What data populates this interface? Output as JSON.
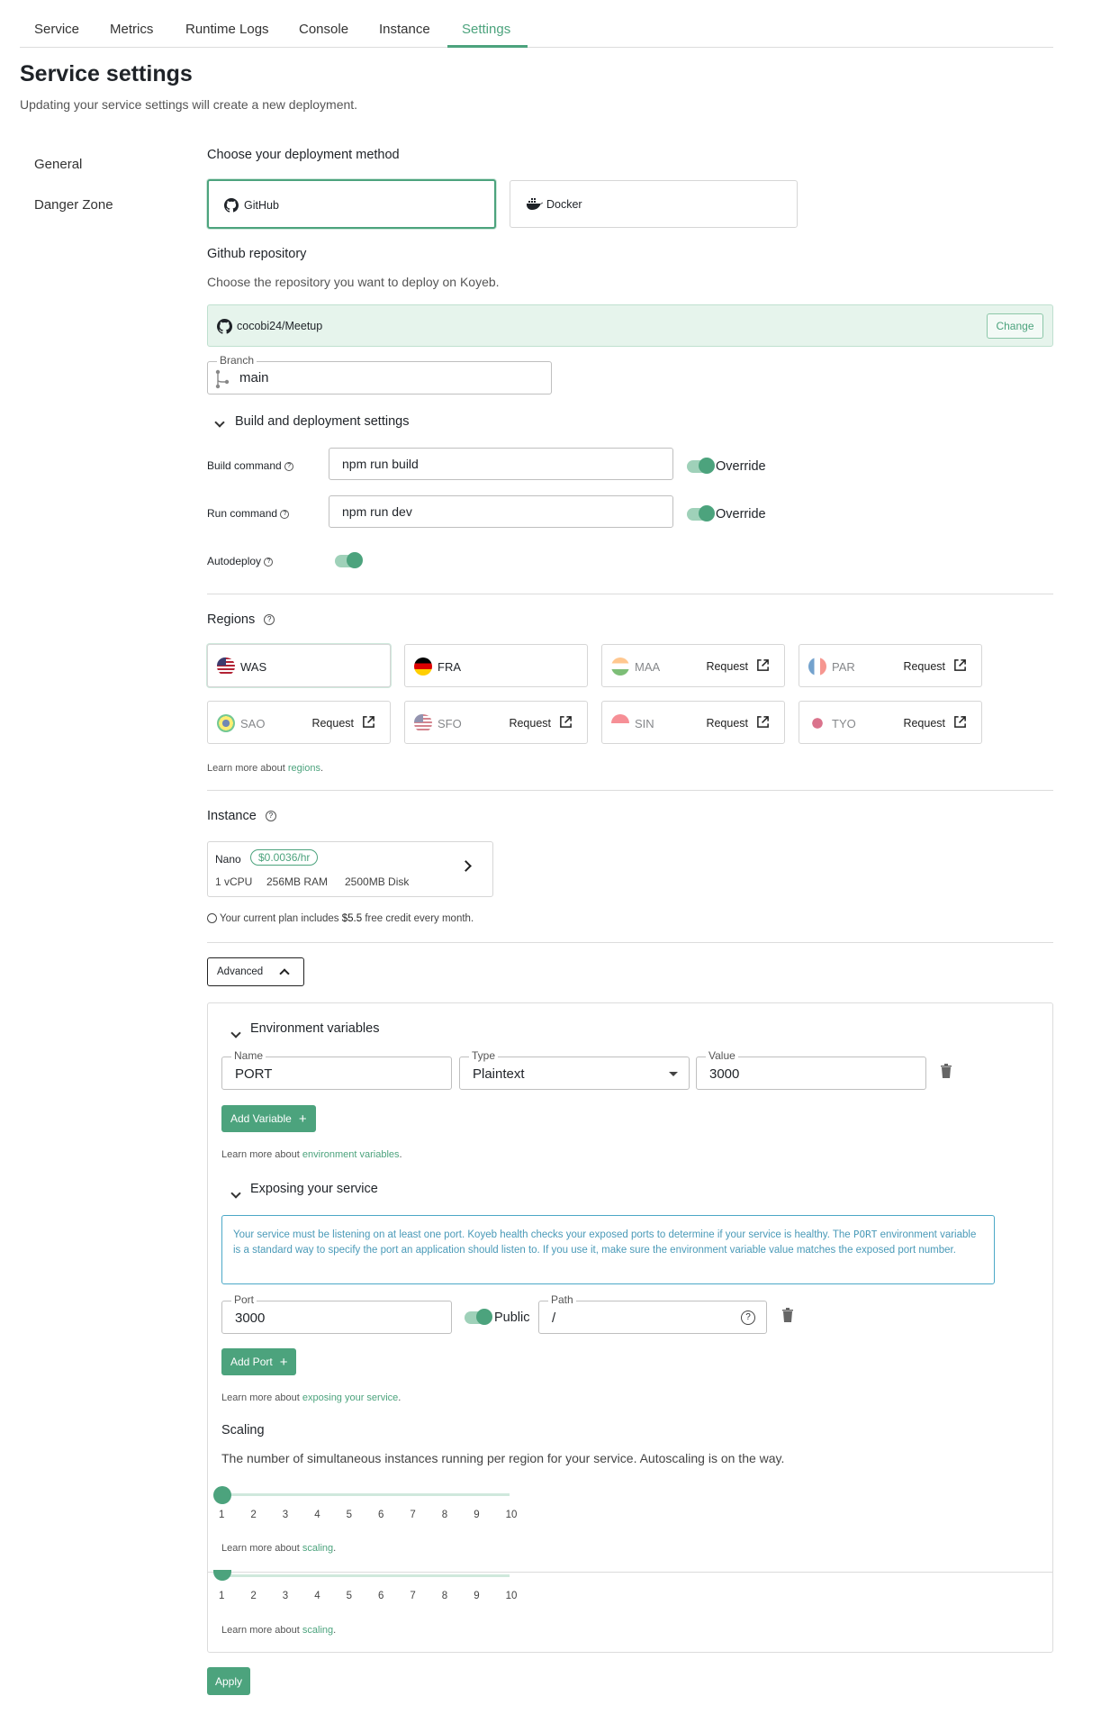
{
  "tabs": [
    "Service",
    "Metrics",
    "Runtime Logs",
    "Console",
    "Instance",
    "Settings"
  ],
  "page": {
    "title": "Service settings",
    "subtitle": "Updating your service settings will create a new deployment."
  },
  "sidebar": [
    "General",
    "Danger Zone"
  ],
  "deploy": {
    "heading": "Choose your deployment method",
    "github": "GitHub",
    "docker": "Docker"
  },
  "repo": {
    "heading": "Github repository",
    "desc": "Choose the repository you want to deploy on Koyeb.",
    "name": "cocobi24/Meetup",
    "change": "Change",
    "branch_label": "Branch",
    "branch": "main"
  },
  "build": {
    "heading": "Build and deployment settings",
    "build_label": "Build command",
    "build_value": "npm run build",
    "run_label": "Run command",
    "run_value": "npm run dev",
    "override": "Override",
    "autodeploy": "Autodeploy"
  },
  "regions": {
    "heading": "Regions",
    "request": "Request",
    "items": [
      {
        "code": "WAS",
        "selected": true
      },
      {
        "code": "FRA"
      },
      {
        "code": "MAA",
        "request": true
      },
      {
        "code": "PAR",
        "request": true
      },
      {
        "code": "SAO",
        "request": true
      },
      {
        "code": "SFO",
        "request": true
      },
      {
        "code": "SIN",
        "request": true
      },
      {
        "code": "TYO",
        "request": true
      }
    ],
    "learn_prefix": "Learn more about ",
    "learn_link": "regions",
    "learn_suffix": "."
  },
  "instance": {
    "heading": "Instance",
    "name": "Nano",
    "price": "$0.0036/hr",
    "cpu": "1 vCPU",
    "ram": "256MB RAM",
    "disk_value": "2500MB",
    "disk_unit": "Disk",
    "credit_prefix": "Your current plan includes ",
    "credit_amount": "$5.5",
    "credit_suffix": " free credit every month."
  },
  "advanced": {
    "label": "Advanced"
  },
  "env": {
    "heading": "Environment variables",
    "name_label": "Name",
    "name_value": "PORT",
    "type_label": "Type",
    "type_value": "Plaintext",
    "value_label": "Value",
    "value_value": "3000",
    "add": "Add Variable",
    "learn_prefix": "Learn more about ",
    "learn_link": "environment variables",
    "learn_suffix": "."
  },
  "expose": {
    "heading": "Exposing your service",
    "info_a": "Your service must be listening on at least one port. Koyeb health checks your exposed ports to determine if your service is healthy. The ",
    "info_code": "PORT",
    "info_b": " environment variable is a standard way to specify the port an application should listen to. If you use it, make sure the environment variable value matches the exposed port number.",
    "port_label": "Port",
    "port_value": "3000",
    "public": "Public",
    "path_label": "Path",
    "path_value": "/",
    "add": "Add Port",
    "learn_prefix": "Learn more about ",
    "learn_link": "exposing your service",
    "learn_suffix": "."
  },
  "scaling": {
    "heading": "Scaling",
    "desc": "The number of simultaneous instances running per region for your service. Autoscaling is on the way.",
    "value": 1,
    "ticks": [
      "1",
      "2",
      "3",
      "4",
      "5",
      "6",
      "7",
      "8",
      "9",
      "10"
    ],
    "learn_prefix": "Learn more about ",
    "learn_link": "scaling",
    "learn_suffix": "."
  },
  "apply": "Apply"
}
